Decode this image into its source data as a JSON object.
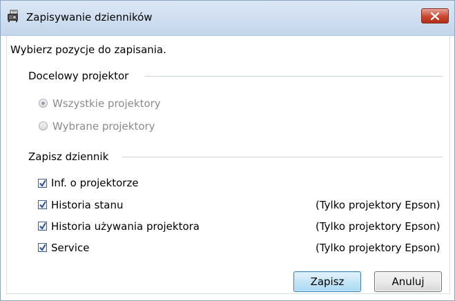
{
  "window": {
    "title": "Zapisywanie dzienników",
    "icon": "projector-save-icon"
  },
  "dialog": {
    "instruction": "Wybierz pozycje do zapisania.",
    "target_group": {
      "label": "Docelowy projektor",
      "options": [
        {
          "label": "Wszystkie projektory",
          "selected": true,
          "enabled": false
        },
        {
          "label": "Wybrane projektory",
          "selected": false,
          "enabled": false
        }
      ]
    },
    "log_group": {
      "label": "Zapisz dziennik",
      "items": [
        {
          "label": "Inf. o projektorze",
          "checked": true,
          "note": ""
        },
        {
          "label": "Historia stanu",
          "checked": true,
          "note": "(Tylko projektory Epson)"
        },
        {
          "label": "Historia używania projektora",
          "checked": true,
          "note": "(Tylko projektory Epson)"
        },
        {
          "label": "Service",
          "checked": true,
          "note": "(Tylko projektory Epson)"
        }
      ]
    },
    "buttons": {
      "save": "Zapisz",
      "cancel": "Anuluj"
    }
  },
  "colors": {
    "close_button": "#c9462f",
    "primary_button": "#c4e5f6",
    "checkbox_check": "#2b4f8a"
  }
}
